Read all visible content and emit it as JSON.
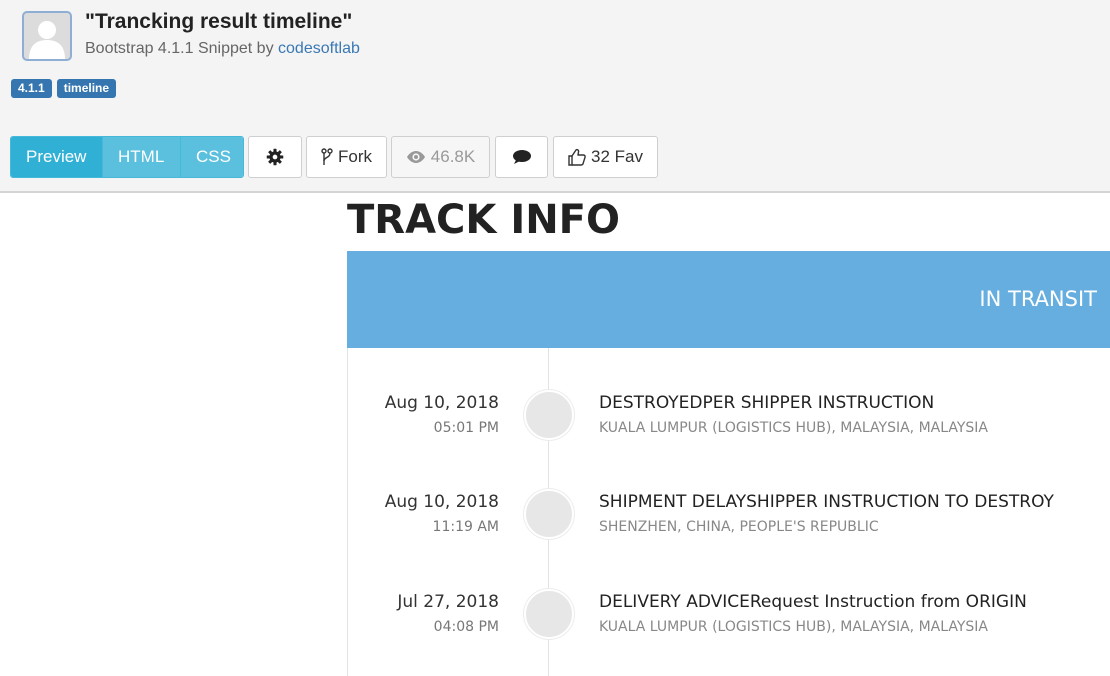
{
  "snippet": {
    "title": "\"Trancking result timeline\"",
    "subtitle_prefix": "Bootstrap 4.1.1 Snippet by",
    "author": "codesoftlab",
    "tags": [
      "4.1.1",
      "timeline"
    ]
  },
  "toolbar": {
    "tabs": [
      "Preview",
      "HTML",
      "CSS"
    ],
    "active_tab": "Preview",
    "settings_icon": "gear-icon",
    "fork_label": "Fork",
    "views_label": "46.8K",
    "comments_icon": "comment-icon",
    "fav_label": "32 Fav"
  },
  "preview": {
    "heading": "TRACK INFO",
    "status": "IN TRANSIT",
    "events": [
      {
        "date": "Aug 10, 2018",
        "time": "05:01 PM",
        "description": "DESTROYEDPER SHIPPER INSTRUCTION",
        "location": "KUALA LUMPUR (LOGISTICS HUB), MALAYSIA, MALAYSIA"
      },
      {
        "date": "Aug 10, 2018",
        "time": "11:19 AM",
        "description": "SHIPMENT DELAYSHIPPER INSTRUCTION TO DESTROY",
        "location": "SHENZHEN, CHINA, PEOPLE'S REPUBLIC"
      },
      {
        "date": "Jul 27, 2018",
        "time": "04:08 PM",
        "description": "DELIVERY ADVICERequest Instruction from ORIGIN",
        "location": "KUALA LUMPUR (LOGISTICS HUB), MALAYSIA, MALAYSIA"
      }
    ]
  },
  "colors": {
    "banner": "#65aedf",
    "tag": "#3576b1",
    "tab_active": "#31b0d5",
    "tab": "#5bc0de",
    "author_link": "#3a78b4"
  }
}
